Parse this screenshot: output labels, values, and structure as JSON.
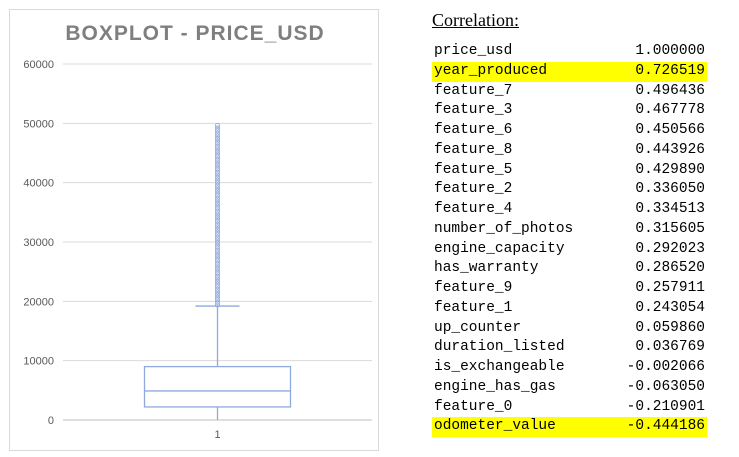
{
  "chart_data": {
    "type": "boxplot",
    "title": "BOXPLOT - PRICE_USD",
    "categories": [
      "1"
    ],
    "y_ticks": [
      "0",
      "10000",
      "20000",
      "30000",
      "40000",
      "50000",
      "60000"
    ],
    "ylim": [
      0,
      60000
    ],
    "grid": true,
    "box": {
      "whisker_low": 1,
      "q1": 2200,
      "median": 4900,
      "q3": 9000,
      "whisker_high": 19200,
      "outliers_from": 19400,
      "outliers_to": 50000
    },
    "box_color": "#8eaadb"
  },
  "correlation": {
    "title": "Correlation:",
    "highlight_color": "#ffff00",
    "rows": [
      {
        "name": "price_usd",
        "value": "1.000000",
        "highlight": false
      },
      {
        "name": "year_produced",
        "value": "0.726519",
        "highlight": true
      },
      {
        "name": "feature_7",
        "value": "0.496436",
        "highlight": false
      },
      {
        "name": "feature_3",
        "value": "0.467778",
        "highlight": false
      },
      {
        "name": "feature_6",
        "value": "0.450566",
        "highlight": false
      },
      {
        "name": "feature_8",
        "value": "0.443926",
        "highlight": false
      },
      {
        "name": "feature_5",
        "value": "0.429890",
        "highlight": false
      },
      {
        "name": "feature_2",
        "value": "0.336050",
        "highlight": false
      },
      {
        "name": "feature_4",
        "value": "0.334513",
        "highlight": false
      },
      {
        "name": "number_of_photos",
        "value": "0.315605",
        "highlight": false
      },
      {
        "name": "engine_capacity",
        "value": "0.292023",
        "highlight": false
      },
      {
        "name": "has_warranty",
        "value": "0.286520",
        "highlight": false
      },
      {
        "name": "feature_9",
        "value": "0.257911",
        "highlight": false
      },
      {
        "name": "feature_1",
        "value": "0.243054",
        "highlight": false
      },
      {
        "name": "up_counter",
        "value": "0.059860",
        "highlight": false
      },
      {
        "name": "duration_listed",
        "value": "0.036769",
        "highlight": false
      },
      {
        "name": "is_exchangeable",
        "value": "-0.002066",
        "highlight": false
      },
      {
        "name": "engine_has_gas",
        "value": "-0.063050",
        "highlight": false
      },
      {
        "name": "feature_0",
        "value": "-0.210901",
        "highlight": false
      },
      {
        "name": "odometer_value",
        "value": "-0.444186",
        "highlight": true
      }
    ]
  }
}
